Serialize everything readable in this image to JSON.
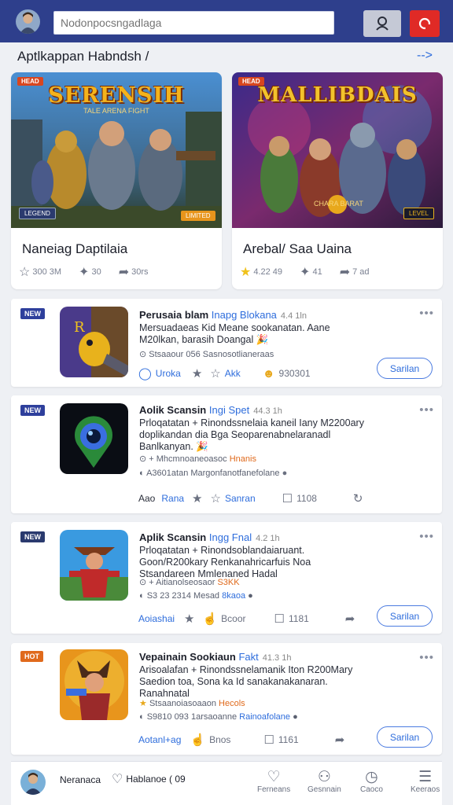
{
  "search": {
    "placeholder": "Nodonpocsngadlaga"
  },
  "section": {
    "title": "Aptlkappan Habndsh /",
    "see_all": "-->"
  },
  "featured": [
    {
      "badge": "HEAD",
      "logo": "SERENSIH",
      "sub": "TALE ARENA FIGHT",
      "tag_left": "LEGEND",
      "tag_right": "LIMITED",
      "name": "Naneiag Daptilaia",
      "stats": [
        {
          "icon": "star-outline-icon",
          "text": "300 3M"
        },
        {
          "icon": "pin-icon",
          "text": "30"
        },
        {
          "icon": "share-icon",
          "text": "30rs"
        }
      ]
    },
    {
      "badge": "HEAD",
      "logo": "MALLIBDAIS",
      "sub": "",
      "tag_left": "CHARA BARAT",
      "tag_right": "LEVEL",
      "name": "Arebal/ Saa Uaina",
      "stats": [
        {
          "icon": "star-filled-icon",
          "text": "4.22 49"
        },
        {
          "icon": "pin-icon",
          "text": "41"
        },
        {
          "icon": "share-icon",
          "text": "7 ad"
        }
      ]
    }
  ],
  "apps": [
    {
      "badge": "NEW",
      "title": "Perusaia blam",
      "title_hl": "Inapg Blokana",
      "version": "4.4 1ln",
      "desc": "Mersuadaeas Kid Meane sookanatan. Aane M20lkan, barasih Doangal 🎉",
      "meta1": "Stsaaour 056 Sasnosotlianeraas",
      "meta1_hl": "",
      "meta2": "",
      "actions": {
        "a1": "Uroka",
        "a2": "Akk",
        "a3": "930301"
      },
      "button": "Sarilan"
    },
    {
      "badge": "NEW",
      "title": "Aolik Scansin",
      "title_hl": "Ingi Spet",
      "version": "44.3 1h",
      "desc": "Prloqatatan + Rinondssnelaia kaneil Iany M2200ary doplikandan dia Bga Seoparenabnelaranadl Banlkanyan. 🎉",
      "meta1": "Mhcmnoaneoasoc",
      "meta1_hl": "Hnanis",
      "meta2": "A3601atan Margonfanotfanefolane",
      "actions": {
        "a1": "Aao",
        "a2": "Rana",
        "a3": "Sanran",
        "a4": "1108"
      },
      "button": ""
    },
    {
      "badge": "NEW",
      "title": "Aplik Scansin",
      "title_hl": "Ingg Fnal",
      "version": "4.2 1h",
      "desc": "Prloqatatan + Rinondsoblandaiaruant. Goon/R200kary Renkanahricarfuis Noa Stsandareen Mmlenaned Hadal",
      "meta1": "Aitianolseosaor",
      "meta1_hl": "S3KK",
      "meta2": "S3 23 2314 Mesad",
      "meta2_hl": "8kaoa",
      "actions": {
        "a1": "Aoiashai",
        "a2": "Bcoor",
        "a3": "1181"
      },
      "button": "Sarilan"
    },
    {
      "badge": "HOT",
      "title": "Vepainain Sookiaun",
      "title_hl": "Fakt",
      "version": "41.3 1h",
      "desc": "Arisoalafan + Rinondssnelamanik Iton R200Mary Saedion toa, Sona ka Id sanakanakanaran. Ranahnatal",
      "meta1": "Stsaanoiasoaaon",
      "meta1_hl": "Hecols",
      "meta2": "S9810 093 1arsaoanne",
      "meta2_hl": "Rainoafolane",
      "actions": {
        "a1": "Aotanl+ag",
        "a2": "Bnos",
        "a3": "1161"
      },
      "button": "Sarilan"
    }
  ],
  "bottom_nav": {
    "user_label": "Neranaca",
    "center_label": "Hablanoe ( 09",
    "items": [
      {
        "icon": "heart-icon",
        "label": "Ferneans"
      },
      {
        "icon": "profile-icon",
        "label": "Gesnnain"
      },
      {
        "icon": "clock-icon",
        "label": "Caoco"
      },
      {
        "icon": "menu-icon",
        "label": "Keeraos"
      }
    ]
  },
  "colors": {
    "topbar": "#2e3f8c",
    "accent": "#2e6ddc",
    "alert": "#e02a26"
  }
}
